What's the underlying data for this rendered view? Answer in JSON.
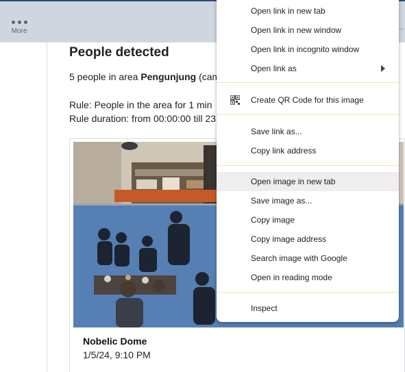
{
  "toolbar": {
    "more_label": "More",
    "edge_glyph": "⋯"
  },
  "email": {
    "heading": "People detected",
    "summary_prefix": "5 people in area ",
    "summary_area": "Pengunjung",
    "summary_suffix": " (cam",
    "rule_line": "Rule: People in the area for 1 min",
    "duration_line": "Rule duration: from 00:00:00 till 23"
  },
  "card": {
    "camera_name": "Nobelic Dome",
    "timestamp": "1/5/24, 9:10 PM",
    "overlay_color": "#1f5fb4"
  },
  "context_menu": {
    "items": [
      "Open link in new tab",
      "Open link in new window",
      "Open link in incognito window",
      "Open link as",
      "Create QR Code for this image",
      "Save link as...",
      "Copy link address",
      "Open image in new tab",
      "Save image as...",
      "Copy image",
      "Copy image address",
      "Search image with Google",
      "Open in reading mode",
      "Inspect"
    ],
    "highlighted": "Open image in new tab",
    "separator_color": "#f1e6a8"
  }
}
